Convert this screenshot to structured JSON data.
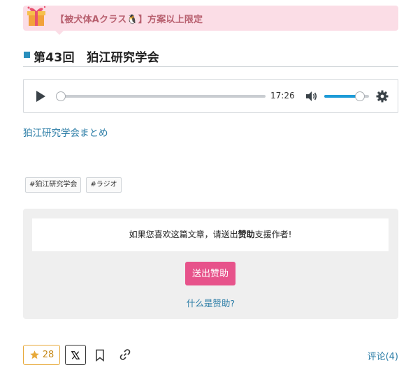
{
  "banner": {
    "text": "【被犬体Aクラス🐧】方案以上限定",
    "icon": "gift-icon",
    "colors": {
      "background": "#fbdde6",
      "text": "#b8606f"
    }
  },
  "article": {
    "title": "第43回　狛江研究学会"
  },
  "player": {
    "duration": "17:26",
    "progress": 0.0,
    "volume": 0.8,
    "icons": [
      "play-icon",
      "volume-icon",
      "gear-icon"
    ]
  },
  "body": {
    "link_text": "狛江研究学会まとめ"
  },
  "tags": [
    "#狛江研究学会",
    "#ラジオ"
  ],
  "support": {
    "message_before": "如果您喜欢这篇文章，请送出",
    "message_bold": "赞助",
    "message_after": "支援作者!",
    "button_label": "送出赞助",
    "help_link": "什么是赞助?",
    "button_color": "#e7538b"
  },
  "footer": {
    "star_count": "28",
    "comments_label": "评论(4)",
    "icons": [
      "star-icon",
      "x-logo-icon",
      "bookmark-icon",
      "link-icon"
    ]
  }
}
